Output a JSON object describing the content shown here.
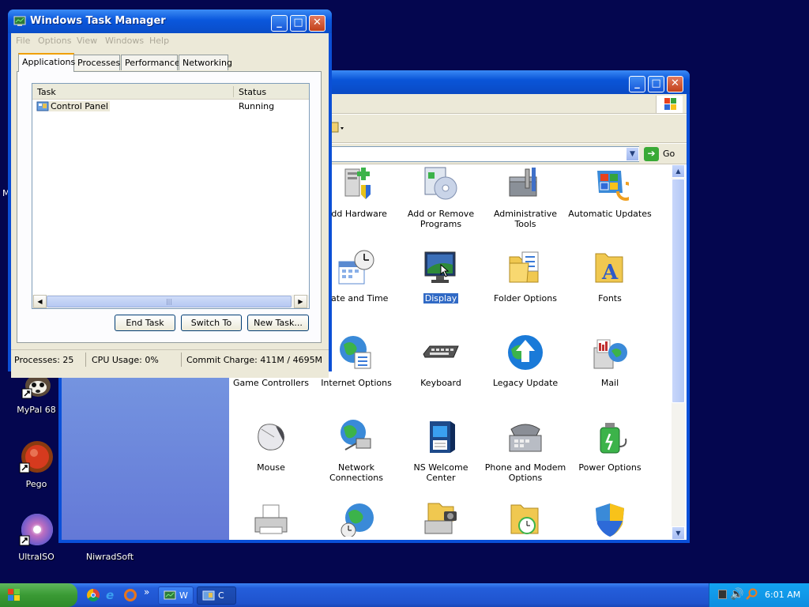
{
  "desktop": {
    "icons": [
      {
        "label": "MyPal 68",
        "name": "mypal"
      },
      {
        "label": "Pego",
        "name": "pego"
      },
      {
        "label": "UltraISO",
        "name": "ultraiso"
      },
      {
        "label": "NiwradSoft",
        "name": "niwradsoft"
      }
    ],
    "partial_label": "M"
  },
  "control_panel": {
    "go_label": "Go",
    "items": [
      {
        "label": "Add Hardware",
        "icon": "add-hardware-icon"
      },
      {
        "label": "Add or Remove Programs",
        "icon": "add-remove-programs-icon"
      },
      {
        "label": "Administrative Tools",
        "icon": "administrative-tools-icon"
      },
      {
        "label": "Automatic Updates",
        "icon": "automatic-updates-icon"
      },
      {
        "label": "Date and Time",
        "icon": "date-time-icon"
      },
      {
        "label": "Display",
        "icon": "display-icon",
        "selected": true
      },
      {
        "label": "Folder Options",
        "icon": "folder-options-icon"
      },
      {
        "label": "Fonts",
        "icon": "fonts-icon"
      },
      {
        "label": "Game Controllers",
        "icon": "game-controllers-icon"
      },
      {
        "label": "Internet Options",
        "icon": "internet-options-icon"
      },
      {
        "label": "Keyboard",
        "icon": "keyboard-icon"
      },
      {
        "label": "Legacy Update",
        "icon": "legacy-update-icon"
      },
      {
        "label": "Mail",
        "icon": "mail-icon"
      },
      {
        "label": "Mouse",
        "icon": "mouse-icon"
      },
      {
        "label": "Network Connections",
        "icon": "network-connections-icon"
      },
      {
        "label": "NS Welcome Center",
        "icon": "ns-welcome-center-icon"
      },
      {
        "label": "Phone and Modem Options",
        "icon": "phone-modem-icon"
      },
      {
        "label": "Power Options",
        "icon": "power-options-icon"
      }
    ]
  },
  "task_manager": {
    "title": "Windows Task Manager",
    "menu": [
      "File",
      "Options",
      "View",
      "Windows",
      "Help"
    ],
    "tabs": [
      "Applications",
      "Processes",
      "Performance",
      "Networking"
    ],
    "active_tab": "Applications",
    "columns": {
      "task": "Task",
      "status": "Status"
    },
    "rows": [
      {
        "task": "Control Panel",
        "status": "Running"
      }
    ],
    "buttons": {
      "end_task": "End Task",
      "switch_to": "Switch To",
      "new_task": "New Task..."
    },
    "statusbar": {
      "processes": "Processes: 25",
      "cpu": "CPU Usage: 0%",
      "commit": "Commit Charge: 411M / 4695M"
    }
  },
  "taskbar": {
    "start": "start",
    "buttons": [
      {
        "label": "W"
      },
      {
        "label": "C"
      }
    ],
    "chevron": "»",
    "clock": "6:01 AM"
  },
  "colors": {
    "desktop": "#04064f",
    "xp_blue": "#0a50d8",
    "selection": "#316ac5"
  }
}
